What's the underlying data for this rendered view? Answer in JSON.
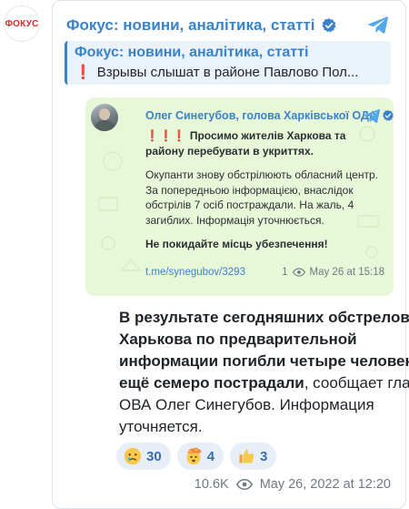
{
  "channel": {
    "avatar_text": "ФОКУС",
    "title": "Фокус: новини, аналітика, статті",
    "verified_icon": "verified-badge-icon",
    "platform_icon": "telegram-icon"
  },
  "reply": {
    "title": "Фокус: новини, аналітика, статті",
    "marker": "❗",
    "text": "Взрывы слышат в районе Павлово Пол..."
  },
  "forwarded": {
    "author": "Олег Синегубов, голова Харківської ОДА",
    "alert_marker": "❗❗❗",
    "alert_text": "Просимо жителів Харкова та району перебувати в укриттях.",
    "paragraph": "Окупанти знову обстрілюють обласний центр. За попередньою інформацією, внаслідок обстрілів 7 осіб постраждали. На жаль, 4 загиблих. Інформація уточнюється.",
    "closing": "Не покидайте місць убезпечення!",
    "link": "t.me/synegubov/3293",
    "views": "1",
    "timestamp": "May 26 at 15:18"
  },
  "post": {
    "bold_text": "В результате сегодняшних обстрелов Харькова по предварительной информации погибли четыре человека, ещё семеро пострадали",
    "rest_text": ", сообщает глава ОВА Олег Синегубов. Информация уточняется.",
    "reactions": [
      {
        "emoji": "crying-face",
        "count": "30"
      },
      {
        "emoji": "exploding-head",
        "count": "4"
      },
      {
        "emoji": "thumbs-up",
        "count": "3"
      }
    ],
    "views": "10.6K",
    "timestamp": "May 26, 2022 at 12:20"
  },
  "colors": {
    "accent": "#3a83c8",
    "brand_red": "#e3262d",
    "forward_bg": "#e9f7d9",
    "reaction_bg": "#e7eef7"
  }
}
